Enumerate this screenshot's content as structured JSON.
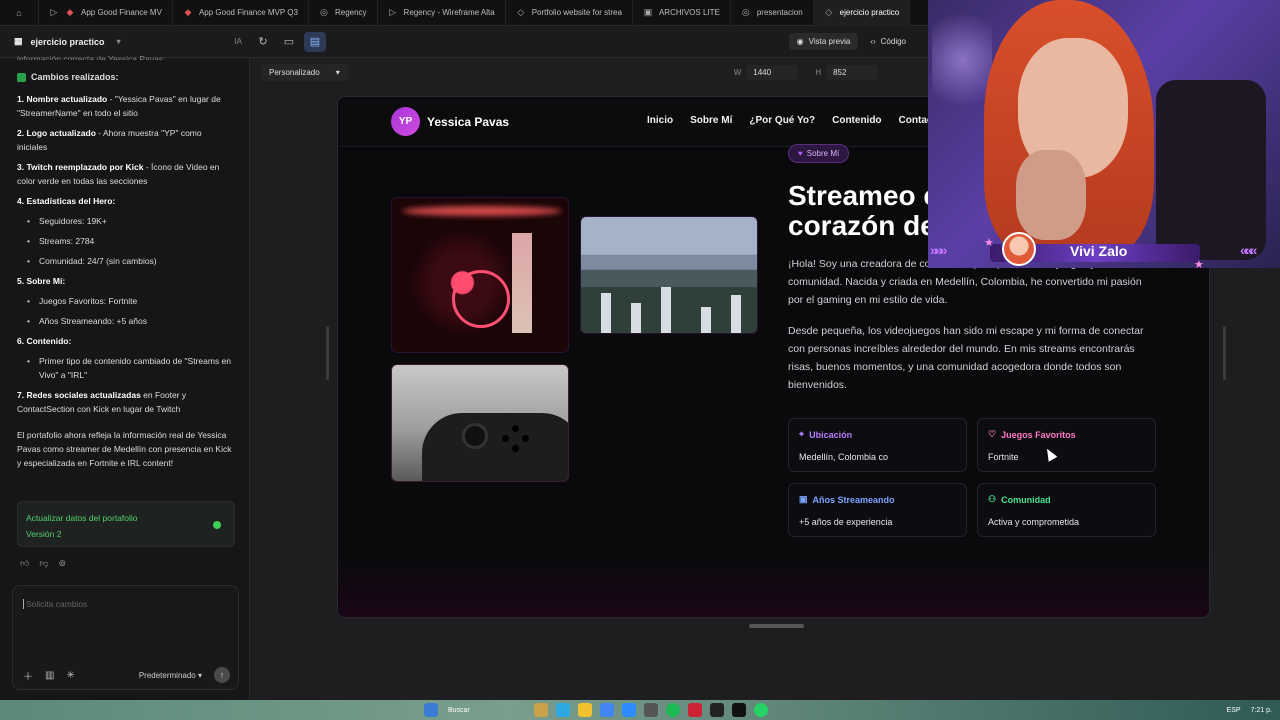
{
  "tabs": [
    {
      "label": "",
      "icon": "home-icon"
    },
    {
      "label": "App Good Finance MV",
      "icon": "play-icon"
    },
    {
      "label": "App Good Finance MVP Q3",
      "icon": "figma-icon"
    },
    {
      "label": "Regency",
      "icon": "globe-icon"
    },
    {
      "label": "Regency - Wireframe Alta",
      "icon": "play-icon"
    },
    {
      "label": "Portfolio website for strea",
      "icon": "diamond-icon"
    },
    {
      "label": "ARCHIVOS LITE",
      "icon": "drive-icon"
    },
    {
      "label": "presentacion",
      "icon": "globe-icon"
    },
    {
      "label": "ejercicio practico",
      "icon": "diamond-icon"
    }
  ],
  "project": {
    "name": "ejercicio practico",
    "ia": "IA"
  },
  "toolbar": {
    "preview_label": "Vista previa",
    "code_label": "Código"
  },
  "canvas": {
    "preset": "Personalizado",
    "w_label": "W",
    "w_value": "1440",
    "h_label": "H",
    "h_value": "852"
  },
  "chat": {
    "top_fragment": "información correcta de Yessica Pavas:",
    "heading": "Cambios realizados:",
    "items": [
      {
        "n": "1.",
        "bold": "Nombre actualizado",
        "text": " - \"Yessica Pavas\" en lugar de \"StreamerName\" en todo el sitio"
      },
      {
        "n": "2.",
        "bold": "Logo actualizado",
        "text": " - Ahora muestra \"YP\" como iniciales"
      },
      {
        "n": "3.",
        "bold": "Twitch reemplazado por Kick",
        "text": " - Ícono de Video en color verde en todas las secciones"
      }
    ],
    "stats_title": "4. Estadísticas del Hero:",
    "stats": [
      "Seguidores: 19K+",
      "Streams: 2784",
      "Comunidad: 24/7 (sin cambios)"
    ],
    "about_title": "5. Sobre Mí:",
    "about": [
      "Juegos Favoritos: Fortnite",
      "Años Streameando: +5 años"
    ],
    "content_title": "6. Contenido:",
    "content": [
      "Primer tipo de contenido cambiado de \"Streams en Vivo\" a \"IRL\""
    ],
    "social_n": "7.",
    "social_bold": "Redes sociales actualizadas",
    "social_text": " en Footer y ContactSection con Kick en lugar de Twitch",
    "summary": "El portafolio ahora refleja la información real de Yessica Pavas como streamer de Medellín con presencia en Kick y especializada en Fortnite e IRL content!"
  },
  "version": {
    "title": "Actualizar datos del portafolio",
    "label": "Versión 2"
  },
  "composer": {
    "placeholder": "Solicita cambios",
    "mode": "Predeterminado"
  },
  "site": {
    "logo_initials": "YP",
    "logo_name": "Yessica Pavas",
    "menu": [
      "Inicio",
      "Sobre Mí",
      "¿Por Qué Yo?",
      "Contenido",
      "Contacto"
    ],
    "badge": "Sobre Mí",
    "headline_1": "Streameo c",
    "headline_2": "corazón de",
    "para1": "¡Hola! Soy una creadora de contenido apa... por los videojuegos y la comunidad. Nacida y criada en Medellín, Colombia, he convertido mi pasión por el gaming en mi estilo de vida.",
    "para2": "Desde pequeña, los videojuegos han sido mi escape y mi forma de conectar con personas increíbles alrededor del mundo. En mis streams encontrarás risas, buenos momentos, y una comunidad acogedora donde todos son bienvenidos.",
    "cards": [
      {
        "key": "Ubicación",
        "value": "Medellín, Colombia co",
        "icon": "location-pin-icon",
        "color": "purple"
      },
      {
        "key": "Juegos Favoritos",
        "value": "Fortnite",
        "icon": "heart-icon",
        "color": "pink"
      },
      {
        "key": "Años Streameando",
        "value": "+5 años de experiencia",
        "icon": "gamepad-icon",
        "color": "blue"
      },
      {
        "key": "Comunidad",
        "value": "Activa y comprometida",
        "icon": "users-icon",
        "color": "green"
      }
    ]
  },
  "webcam": {
    "streamer_name": "Vivi Zalo"
  },
  "taskbar": {
    "search": "Buscar",
    "lang": "ESP",
    "time": "7:21 p."
  }
}
